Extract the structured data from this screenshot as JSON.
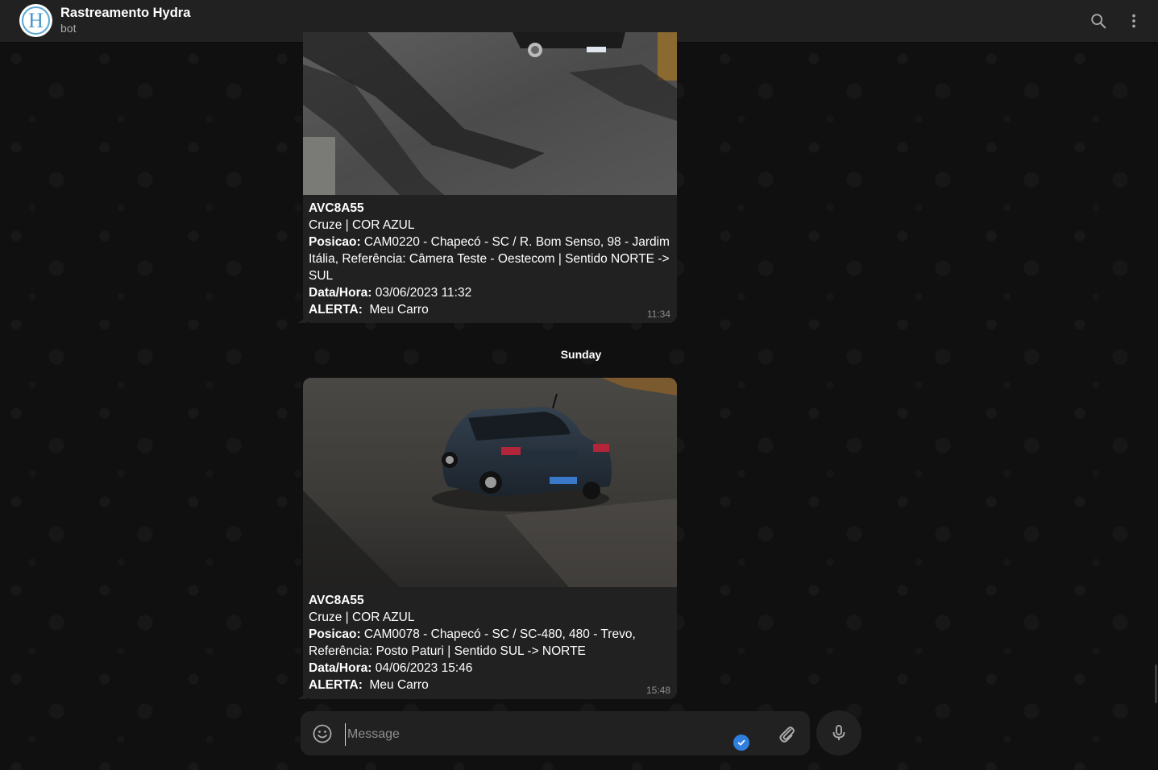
{
  "header": {
    "avatar_letter": "H",
    "title": "Rastreamento Hydra",
    "subtitle": "bot",
    "icons": [
      "search-icon",
      "more-vertical-icon"
    ]
  },
  "messages": [
    {
      "plate": "AVC8A55",
      "model": "Cruze | COR AZUL",
      "posicao_label": "Posicao:",
      "posicao": "CAM0220 - Chapecó - SC / R. Bom Senso, 98 - Jardim Itália, Referência: Câmera Teste - Oestecom | Sentido NORTE -> SUL",
      "datahora_label": "Data/Hora:",
      "datahora": "03/06/2023 11:32",
      "alerta_label": "ALERTA:",
      "alerta": "Meu Carro",
      "time": "11:34"
    },
    {
      "plate": "AVC8A55",
      "model": "Cruze | COR AZUL",
      "posicao_label": "Posicao:",
      "posicao": "CAM0078 - Chapecó - SC / SC-480, 480 - Trevo, Referência: Posto Paturi | Sentido SUL -> NORTE",
      "datahora_label": "Data/Hora:",
      "datahora": "04/06/2023 15:46",
      "alerta_label": "ALERTA:",
      "alerta": "Meu Carro",
      "time": "15:48"
    }
  ],
  "date_separator": "Sunday",
  "composer": {
    "placeholder": "Message",
    "icons": [
      "emoji-icon",
      "attach-icon",
      "microphone-icon",
      "check-badge-icon"
    ]
  },
  "colors": {
    "header_bg": "#212121",
    "bubble_bg": "#212121",
    "chat_bg": "#101010",
    "accent_blue": "#2f7fe0",
    "timestamp": "#8d8d8d"
  }
}
